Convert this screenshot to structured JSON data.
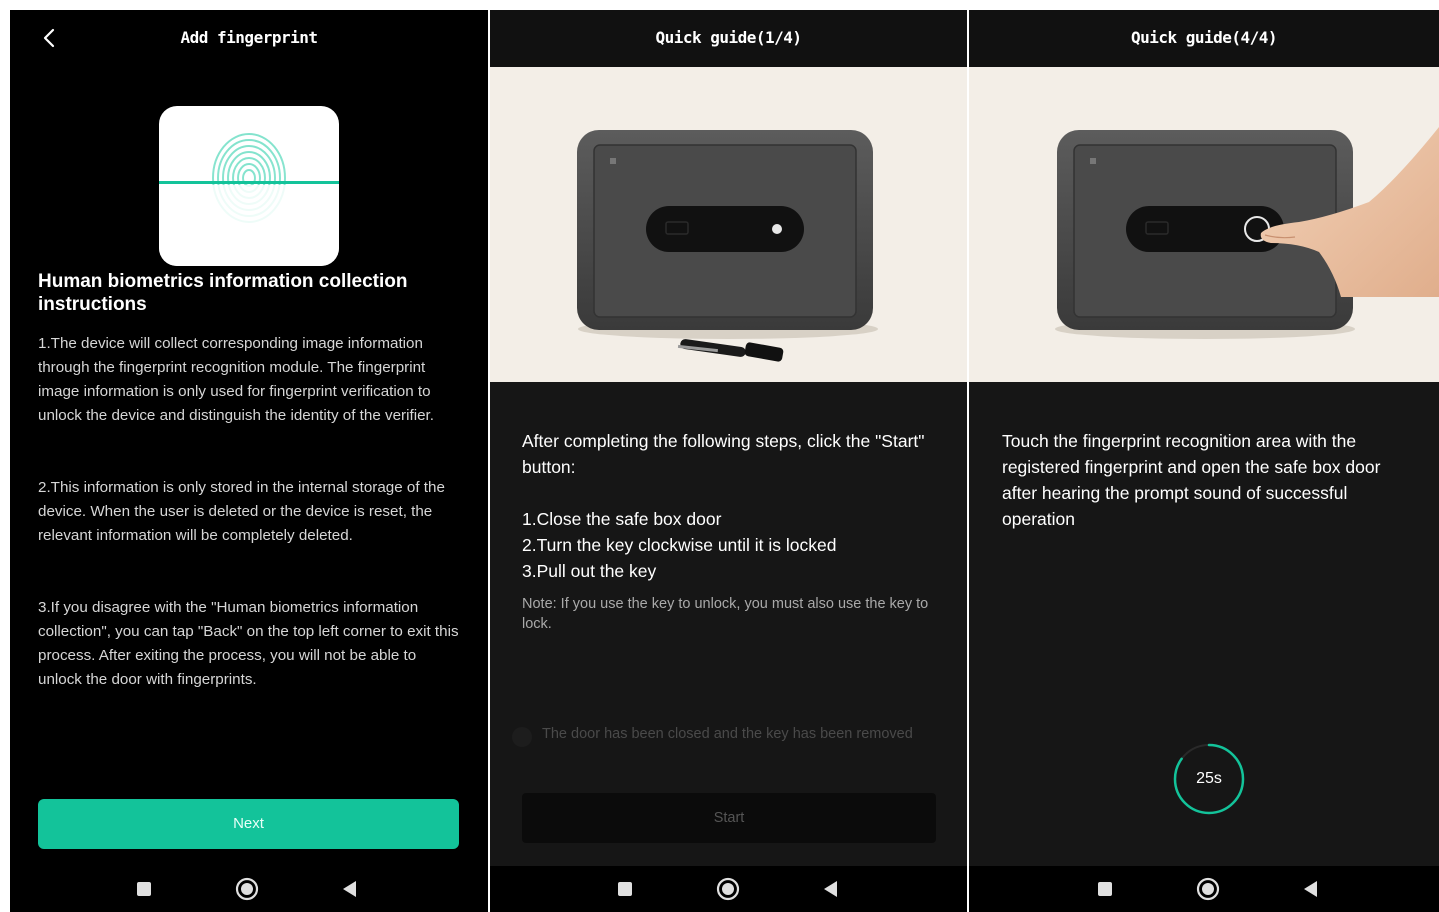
{
  "screens": [
    {
      "header": "Add fingerprint",
      "title": "Human biometrics information collection instructions",
      "paragraphs": [
        "1.The device will collect corresponding image information through the fingerprint recognition module. The fingerprint image information is only used for fingerprint verification to unlock the device and distinguish the identity of the verifier.",
        "2.This information is only stored in the internal storage of the device. When the user is deleted or the device is reset, the relevant information will be completely deleted.",
        "3.If you disagree with the \"Human biometrics information collection\", you can tap \"Back\" on the top left corner to exit this process. After exiting the process, you will not be able to unlock the door with fingerprints."
      ],
      "button": "Next"
    },
    {
      "header": "Quick guide(1/4)",
      "intro": "After completing the following steps, click the \"Start\" button:",
      "steps": [
        "1.Close the safe box door",
        "2.Turn the key clockwise until it is locked",
        "3.Pull out the key"
      ],
      "note": "Note: If you use the key to unlock, you must also use the key to lock.",
      "checkbox_label": "The door has been closed and the key has been removed",
      "button": "Start"
    },
    {
      "header": "Quick guide(4/4)",
      "instruction": "Touch the fingerprint recognition area with the registered fingerprint and open the safe box door after hearing the prompt sound of successful operation",
      "timer": "25s",
      "timer_progress": 0.85
    }
  ],
  "icons": {
    "back": "chevron-left-icon",
    "nav_recent": "square-icon",
    "nav_home": "circle-icon",
    "nav_back": "triangle-left-icon"
  },
  "colors": {
    "accent": "#13c39a",
    "background": "#161616",
    "text": "#ffffff"
  }
}
